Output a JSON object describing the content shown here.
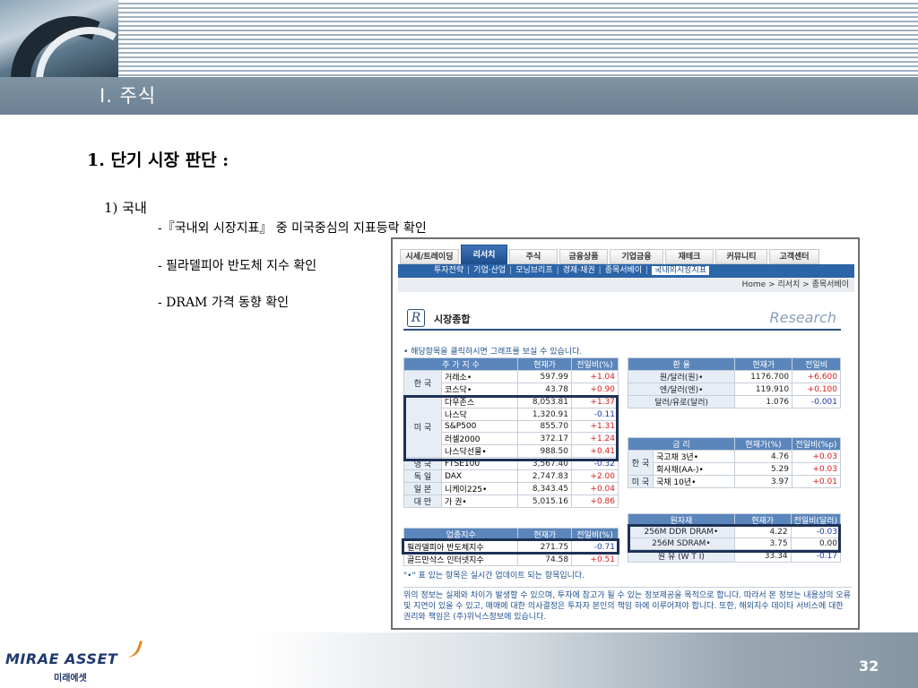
{
  "slide": {
    "section_title": "Ⅰ. 주식",
    "heading": "1. 단기 시장 판단 :",
    "subheading": "1) 국내",
    "bullets": [
      "-『국내외 시장지표』 중 미국중심의 지표등락 확인",
      "- 필라델피아 반도체 지수 확인",
      "- DRAM 가격 동향 확인"
    ],
    "page_number": "32",
    "logo_text": "MIRAE ASSET",
    "logo_sub": "미래에셋"
  },
  "site": {
    "nav_tabs": [
      "시세/트레이딩",
      "리서치",
      "주식",
      "금융상품",
      "기업금융",
      "재테크",
      "커뮤니티",
      "고객센터"
    ],
    "active_tab": "리서치",
    "sub_nav": [
      "투자전략",
      "기업·산업",
      "모닝브리프",
      "경제·채권",
      "종목서베이",
      "국내외시장지표"
    ],
    "sub_nav_current": "국내외시장지표",
    "breadcrumb": "Home > 리서치 > 종목서베이",
    "section_title": "시장종합",
    "logo_letter": "R",
    "research_label": "Research",
    "note_top": "• 해당항목을 클릭하시면 그래프를 보실 수 있습니다.",
    "note_bottom": "\"•\" 표 있는 항목은 실시간 업데이트 되는 항목입니다.",
    "disclaimer": "위의 정보는 실제와 차이가 발생할 수 있으며, 투자에 참고가 될 수 있는 정보제공을 목적으로 합니다. 따라서 본 정보는 내용상의 오류 및 지연이 있을 수 있고, 매매에 대한 의사결정은 투자자 본인의 책임 하에 이루어져야 합니다. 또한, 해외지수 데이타 서비스에 대한 권리와 책임은 (주)위닉스정보에 있습니다."
  },
  "stock_index": {
    "headers": [
      "주 가 지 수",
      "현재가",
      "전일비(%)"
    ],
    "groups": [
      {
        "country": "한 국",
        "rows": [
          {
            "name": "거래소•",
            "price": "597.99",
            "change": "+1.04"
          },
          {
            "name": "코스닥•",
            "price": "43.78",
            "change": "+0.90"
          }
        ]
      },
      {
        "country": "미 국",
        "rows": [
          {
            "name": "다우존스",
            "price": "8,053.81",
            "change": "+1.37"
          },
          {
            "name": "나스닥",
            "price": "1,320.91",
            "change": "-0.11"
          },
          {
            "name": "S&P500",
            "price": "855.70",
            "change": "+1.31"
          },
          {
            "name": "러셀2000",
            "price": "372.17",
            "change": "+1.24"
          },
          {
            "name": "나스닥선물•",
            "price": "988.50",
            "change": "+0.41"
          }
        ]
      },
      {
        "country": "영 국",
        "rows": [
          {
            "name": "FTSE100",
            "price": "3,567.40",
            "change": "-0.32"
          }
        ]
      },
      {
        "country": "독 일",
        "rows": [
          {
            "name": "DAX",
            "price": "2,747.83",
            "change": "+2.00"
          }
        ]
      },
      {
        "country": "일 본",
        "rows": [
          {
            "name": "니케이225•",
            "price": "8,343.45",
            "change": "+0.04"
          }
        ]
      },
      {
        "country": "대 만",
        "rows": [
          {
            "name": "가 권•",
            "price": "5,015.16",
            "change": "+0.86"
          }
        ]
      }
    ]
  },
  "sector_index": {
    "headers": [
      "업종지수",
      "현재가",
      "전일비(%)"
    ],
    "rows": [
      {
        "name": "필라델피아 반도체지수",
        "price": "271.75",
        "change": "-0.71"
      },
      {
        "name": "골드만삭스 인터넷지수",
        "price": "74.58",
        "change": "+0.51"
      }
    ]
  },
  "fx": {
    "headers": [
      "환 율",
      "현재가",
      "전일비"
    ],
    "rows": [
      {
        "name": "원/달러(원)•",
        "price": "1176.700",
        "change": "+6.600"
      },
      {
        "name": "엔/달러(엔)•",
        "price": "119.910",
        "change": "+0.100"
      },
      {
        "name": "달러/유로(달러)",
        "price": "1.076",
        "change": "-0.001"
      }
    ]
  },
  "rates": {
    "headers": [
      "금 리",
      "현재가(%)",
      "전일비(%p)"
    ],
    "groups": [
      {
        "country": "한 국",
        "rows": [
          {
            "name": "국고채 3년•",
            "price": "4.76",
            "change": "+0.03"
          },
          {
            "name": "회사채(AA-)•",
            "price": "5.29",
            "change": "+0.03"
          }
        ]
      },
      {
        "country": "미 국",
        "rows": [
          {
            "name": "국채 10년•",
            "price": "3.97",
            "change": "+0.01"
          }
        ]
      }
    ]
  },
  "commodities": {
    "headers": [
      "원자재",
      "현재가",
      "전일비(달러)"
    ],
    "rows": [
      {
        "name": "256M DDR DRAM•",
        "price": "4.22",
        "change": "-0.03"
      },
      {
        "name": "256M SDRAM•",
        "price": "3.75",
        "change": "0.00"
      },
      {
        "name": "원 유 (W T I)",
        "price": "33.34",
        "change": "-0.17"
      }
    ]
  },
  "colors": {
    "positive": "#d81b1b",
    "negative": "#1a3aa8",
    "header_blue": "#5b86bb",
    "slide_bar": "#6b8193"
  }
}
